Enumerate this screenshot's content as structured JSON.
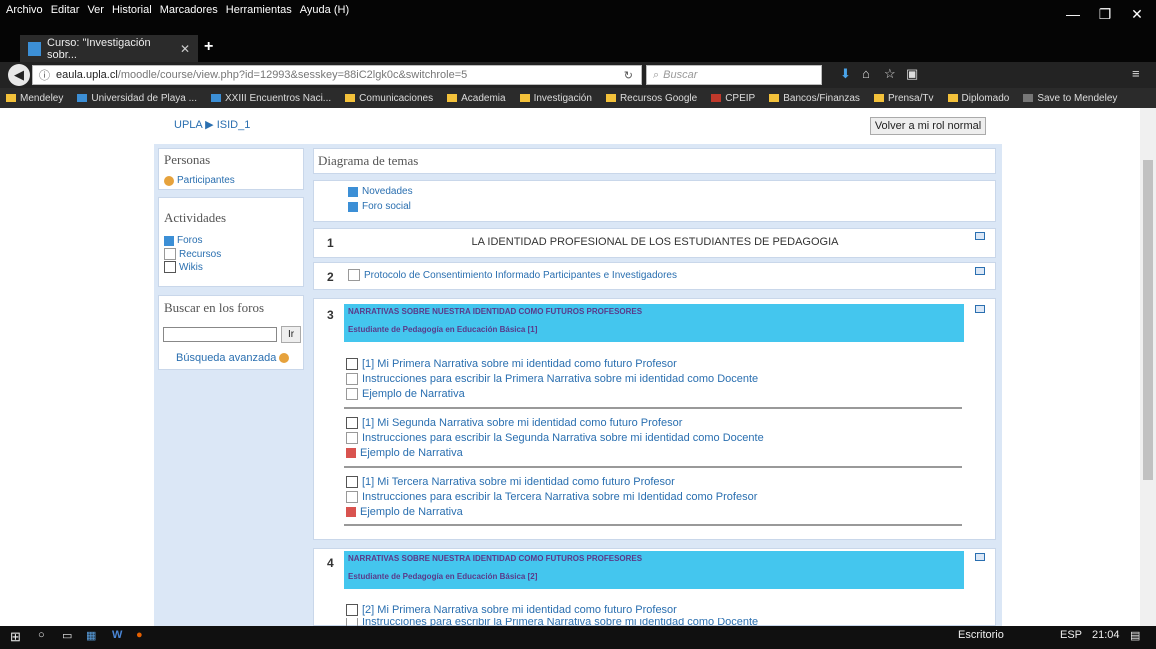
{
  "menu": [
    "Archivo",
    "Editar",
    "Ver",
    "Historial",
    "Marcadores",
    "Herramientas",
    "Ayuda (H)"
  ],
  "tab": {
    "title": "Curso: \"Investigación sobr...",
    "close": "✕",
    "new": "+"
  },
  "url": {
    "host": "eaula.upla.cl",
    "path": "/moodle/course/view.php?id=12993&sesskey=88iC2lgk0c&switchrole=5",
    "search_placeholder": "Buscar"
  },
  "bookmarks": [
    "Mendeley",
    "Universidad de Playa ...",
    "XXIII Encuentros Naci...",
    "Comunicaciones",
    "Academia",
    "Investigación",
    "Recursos Google",
    "CPEIP",
    "Bancos/Finanzas",
    "Prensa/Tv",
    "Diplomado",
    "Save to Mendeley"
  ],
  "page": {
    "breadcrumb": "UPLA ▶ ISID_1",
    "role_button": "Volver a mi rol normal",
    "personas": {
      "title": "Personas",
      "link": "Participantes"
    },
    "actividades": {
      "title": "Actividades",
      "links": [
        "Foros",
        "Recursos",
        "Wikis"
      ]
    },
    "buscar": {
      "title": "Buscar en los foros",
      "button": "Ir",
      "advanced": "Búsqueda avanzada"
    },
    "diagram_title": "Diagrama de temas",
    "section0": {
      "links": [
        "Novedades",
        "Foro social"
      ]
    },
    "section1": {
      "num": "1",
      "title": "LA IDENTIDAD PROFESIONAL DE LOS ESTUDIANTES DE PEDAGOGIA"
    },
    "section2": {
      "num": "2",
      "link": "Protocolo de Consentimiento Informado Participantes e Investigadores"
    },
    "section3": {
      "num": "3",
      "banner1": "NARRATIVAS SOBRE NUESTRA IDENTIDAD COMO FUTUROS PROFESORES",
      "banner2": "Estudiante de Pedagogía en Educación Básica [1]",
      "g1": [
        "[1] Mi Primera Narrativa sobre mi identidad como futuro Profesor",
        "Instrucciones para escribir la Primera Narrativa sobre mi identidad como Docente",
        "Ejemplo de Narrativa"
      ],
      "g2": [
        "[1] Mi Segunda Narrativa sobre mi identidad como futuro Profesor",
        "Instrucciones para escribir la Segunda Narrativa sobre mi identidad como Docente",
        "Ejemplo de Narrativa"
      ],
      "g3": [
        "[1] Mi Tercera Narrativa sobre mi identidad como futuro Profesor",
        "Instrucciones para escribir la Tercera Narrativa sobre mi Identidad como Profesor",
        "Ejemplo de Narrativa"
      ]
    },
    "section4": {
      "num": "4",
      "banner1": "NARRATIVAS SOBRE NUESTRA IDENTIDAD COMO FUTUROS PROFESORES",
      "banner2": "Estudiante de Pedagogía en Educación Básica [2]",
      "g1": [
        "[2] Mi Primera Narrativa sobre mi identidad como futuro Profesor",
        "Instrucciones para escribir la Primera Narrativa sobre mi identidad como Docente"
      ]
    }
  },
  "taskbar": {
    "desktop": "Escritorio",
    "lang": "ESP",
    "time": "21:04"
  },
  "colors": {
    "accent": "#44c6ee",
    "link": "#2a6fb0",
    "sidebar": "#dbe7f6"
  }
}
